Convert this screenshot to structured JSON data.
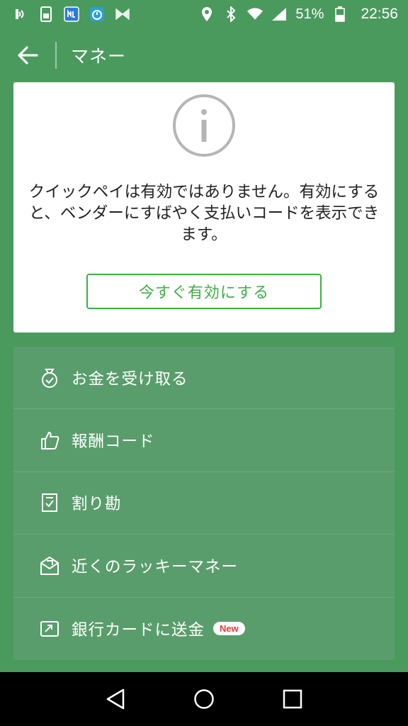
{
  "status_bar": {
    "battery": "51%",
    "time": "22:56",
    "icons_left": [
      "nfc-icon",
      "sim-icon",
      "app-icon",
      "timer-icon",
      "butterfly-icon"
    ],
    "icons_right": [
      "location-icon",
      "bluetooth-icon",
      "wifi-icon",
      "signal-icon",
      "battery-icon"
    ]
  },
  "appbar": {
    "title": "マネー"
  },
  "info_card": {
    "message": "クイックペイは有効ではありません。有効にすると、ベンダーにすばやく支払いコードを表示できます。",
    "button_label": "今すぐ有効にする"
  },
  "menu": {
    "items": [
      {
        "label": "お金を受け取る",
        "icon": "money-bag-icon"
      },
      {
        "label": "報酬コード",
        "icon": "thumbs-up-icon"
      },
      {
        "label": "割り勘",
        "icon": "receipt-icon"
      },
      {
        "label": "近くのラッキーマネー",
        "icon": "envelope-icon"
      },
      {
        "label": "銀行カードに送金",
        "icon": "bank-transfer-icon",
        "badge": "New"
      }
    ]
  },
  "colors": {
    "background": "#4a9a5e",
    "menu": "#5a9d6c",
    "accent": "#3cb043",
    "badge": "#e53935"
  }
}
